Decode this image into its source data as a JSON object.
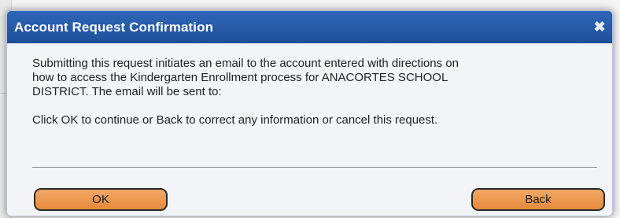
{
  "dialog": {
    "title": "Account Request Confirmation",
    "close_glyph": "✖",
    "close_icon": "close-icon",
    "message_line1": "Submitting this request initiates an email to the account entered with directions on",
    "message_line2": "how to access the Kindergarten Enrollment process for ANACORTES SCHOOL",
    "message_line3": "DISTRICT. The email will be sent to:",
    "instructions": "Click OK to continue or Back to correct any information or cancel this request.",
    "ok_label": "OK",
    "back_label": "Back"
  },
  "colors": {
    "titlebar": "#2a5fad",
    "button": "#ee9a50",
    "dialog_background": "#f2f4f8"
  }
}
